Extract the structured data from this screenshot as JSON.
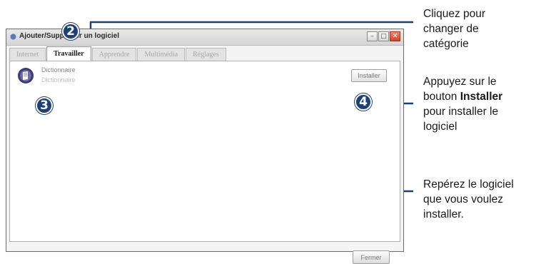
{
  "window": {
    "title": "Ajouter/Supprimer un logiciel",
    "tabs": [
      {
        "label": "Internet",
        "active": false
      },
      {
        "label": "Travailler",
        "active": true
      },
      {
        "label": "Apprendre",
        "active": false
      },
      {
        "label": "Multimédia",
        "active": false
      },
      {
        "label": "Réglages",
        "active": false
      }
    ],
    "package": {
      "name": "Dictionnaire",
      "description": "Dictionnaire",
      "icon": "dictionary-icon"
    },
    "install_label": "Installer",
    "close_label": "Fermer",
    "controls": [
      "minimize-icon",
      "maximize-icon",
      "close-icon"
    ]
  },
  "callouts": {
    "badges": [
      "2",
      "3",
      "4"
    ],
    "color": "#1f3f77",
    "note_category": [
      "Cliquez pour",
      "changer de",
      "catégorie"
    ],
    "note_install": {
      "line1": "Appuyez sur le",
      "line2_prefix": "bouton ",
      "line2_bold": "Installer",
      "line3": "pour installer le",
      "line4": "logiciel"
    },
    "note_locate": [
      "Repérez le logiciel",
      "que vous voulez",
      "installer."
    ]
  }
}
